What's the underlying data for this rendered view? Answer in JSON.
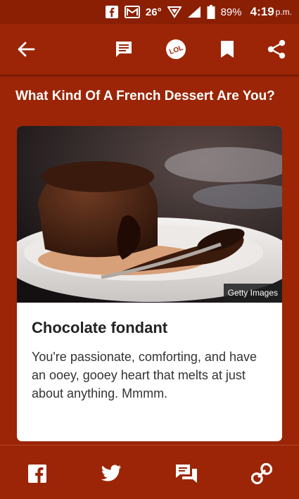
{
  "status_bar": {
    "temperature": "26°",
    "battery": "89%",
    "time": "4:19",
    "ampm": "p.m."
  },
  "toolbar": {
    "icons": [
      "back-arrow-icon",
      "comment-icon",
      "lol-icon",
      "bookmark-icon",
      "share-icon"
    ],
    "lol_label": "LOL"
  },
  "quiz": {
    "title": "What Kind Of A French Dessert Are You?"
  },
  "result": {
    "image_credit": "Getty Images",
    "name": "Chocolate fondant",
    "description": "You're passionate, comforting, and have an ooey, gooey heart that melts at just about anything. Mmmm."
  },
  "share_bar": {
    "icons": [
      "facebook-icon",
      "twitter-icon",
      "messages-icon",
      "link-icon"
    ]
  },
  "colors": {
    "brand_background": "#9b2506",
    "card_background": "#ffffff"
  }
}
